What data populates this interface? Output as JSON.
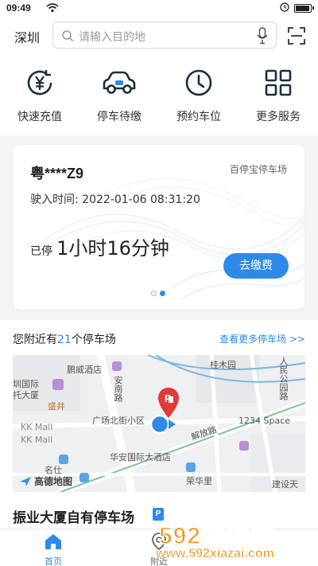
{
  "status_bar": {
    "time": "09:49"
  },
  "header": {
    "city": "深圳",
    "search_placeholder": "请输入目的地"
  },
  "quick_actions": [
    {
      "label": "快速充值",
      "icon": "yen-recharge-icon"
    },
    {
      "label": "停车待缴",
      "icon": "car-icon"
    },
    {
      "label": "预约车位",
      "icon": "clock-icon"
    },
    {
      "label": "更多服务",
      "icon": "grid-icon"
    }
  ],
  "parking_card": {
    "plate": "粤****Z9",
    "lot_name": "百停宝停车场",
    "entry_label": "驶入时间:",
    "entry_time": "2022-01-06 08:31:20",
    "parked_prefix": "已停",
    "duration": "1小时16分钟",
    "pay_label": "去缴费",
    "carousel_pages": 2,
    "carousel_active": 2
  },
  "nearby": {
    "prefix": "您附近有",
    "count": "21",
    "suffix": "个停车场",
    "more_label": "查看更多停车场 >>"
  },
  "map": {
    "labels": {
      "pengwei": "鹏威酒店",
      "annan": "安南路",
      "guimu": "桂木园",
      "renmin": "人民公园路",
      "hotel_l1": "圳国际",
      "hotel_l2": "托大厦",
      "shengjing": "盛井",
      "kk1": "KK Mall",
      "kk2": "KK Mall",
      "guangchang": "广场北街小区",
      "jiefang": "解放路",
      "space": "1234 Space",
      "huaan": "华安国际大酒店",
      "mingshi": "名仕",
      "rongli": "荣华里",
      "jianshe": "建设天",
      "gaode": "高德地图"
    },
    "accent": "#e03a3a"
  },
  "featured_lot": {
    "name": "振业大厦自有停车场",
    "tag": "P"
  },
  "tabs": [
    {
      "label": "首页",
      "active": true
    },
    {
      "label": "附近",
      "active": false
    }
  ],
  "watermark": {
    "brand": "592软件园",
    "url": "www.592xiazai.com"
  },
  "colors": {
    "accent": "#2e8ae6",
    "watermark": "#f7941d"
  }
}
